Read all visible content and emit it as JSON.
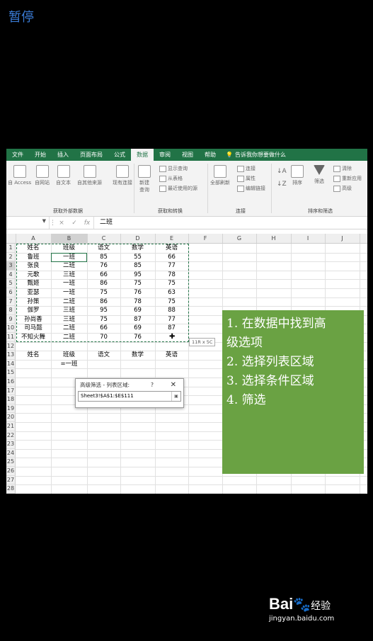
{
  "overlay": {
    "pause_label": "暂停"
  },
  "ribbon": {
    "tabs": [
      "文件",
      "开始",
      "插入",
      "页面布局",
      "公式",
      "数据",
      "审阅",
      "视图",
      "帮助"
    ],
    "active_tab": "数据",
    "tell_me": "告诉我你想要做什么",
    "get_external": {
      "buttons": [
        "自 Access",
        "自网站",
        "自文本",
        "自其他来源",
        "现有连接"
      ],
      "label": "获取外部数据"
    },
    "get_transform": {
      "new_query": "新建\n查询",
      "small": [
        "显示查询",
        "从表格",
        "最近使用的源"
      ],
      "label": "获取和转换"
    },
    "connections": {
      "refresh_all": "全部刷新",
      "small": [
        "连接",
        "属性",
        "编辑链接"
      ],
      "label": "连接"
    },
    "sort_filter": {
      "sort": "排序",
      "filter": "筛选",
      "small": [
        "清除",
        "重新应用",
        "高级"
      ],
      "label": "排序和筛选"
    }
  },
  "formula_bar": {
    "name_box": "",
    "cancel": "×",
    "enter": "✓",
    "fx": "fx",
    "value": "二班"
  },
  "grid": {
    "columns": [
      "A",
      "B",
      "C",
      "D",
      "E",
      "F",
      "G",
      "H",
      "I",
      "J"
    ],
    "rows": [
      "1",
      "2",
      "3",
      "4",
      "5",
      "6",
      "7",
      "8",
      "9",
      "10",
      "11",
      "12",
      "13",
      "14",
      "15",
      "16",
      "17",
      "18",
      "19",
      "20",
      "21",
      "22",
      "23",
      "24",
      "25",
      "26",
      "27",
      "28"
    ],
    "data": [
      [
        "姓名",
        "班级",
        "语文",
        "数学",
        "英语"
      ],
      [
        "鲁班",
        "一班",
        "85",
        "55",
        "66"
      ],
      [
        "张良",
        "二班",
        "76",
        "85",
        "77"
      ],
      [
        "元歌",
        "三班",
        "66",
        "95",
        "78"
      ],
      [
        "甄姬",
        "一班",
        "86",
        "75",
        "75"
      ],
      [
        "亚瑟",
        "一班",
        "75",
        "76",
        "63"
      ],
      [
        "孙策",
        "二班",
        "86",
        "78",
        "75"
      ],
      [
        "伽罗",
        "三班",
        "95",
        "69",
        "88"
      ],
      [
        "孙尚香",
        "三班",
        "75",
        "87",
        "77"
      ],
      [
        "司马懿",
        "二班",
        "66",
        "69",
        "87"
      ],
      [
        "不知火舞",
        "二班",
        "70",
        "76",
        ""
      ]
    ],
    "criteria_headers": [
      "姓名",
      "班级",
      "语文",
      "数学",
      "英语"
    ],
    "criteria_value": "=一班",
    "size_tip": "11R x 5C"
  },
  "instructions": [
    "1. 在数据中找到高",
    "级选项",
    "2. 选择列表区域",
    "3. 选择条件区域",
    "4. 筛选"
  ],
  "dialog": {
    "title": "高级筛选 - 列表区域:",
    "help": "?",
    "close": "✕",
    "value": "Sheet3!$A$1:$E$111"
  },
  "footer": {
    "logo_left": "Bai",
    "logo_paw": "🐾",
    "logo_right": "经验",
    "url": "jingyan.baidu.com"
  }
}
